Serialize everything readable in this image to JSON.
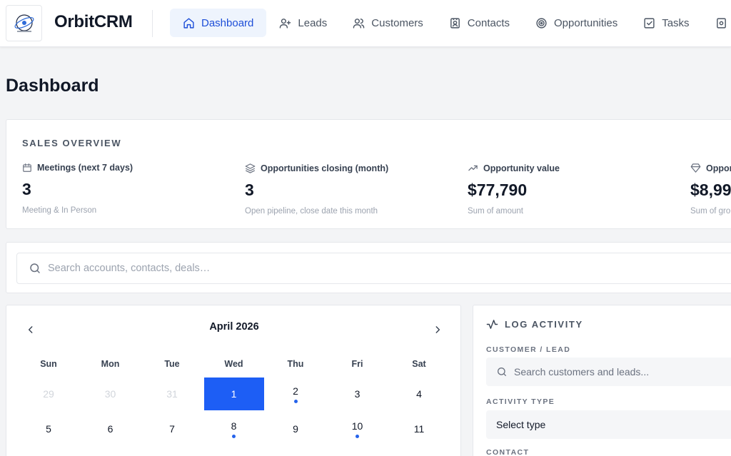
{
  "app": {
    "brand": "OrbitCRM"
  },
  "nav": [
    {
      "label": "Dashboard",
      "icon": "home-icon",
      "active": true
    },
    {
      "label": "Leads",
      "icon": "user-plus-icon"
    },
    {
      "label": "Customers",
      "icon": "users-icon"
    },
    {
      "label": "Contacts",
      "icon": "contact-card-icon"
    },
    {
      "label": "Opportunities",
      "icon": "target-icon"
    },
    {
      "label": "Tasks",
      "icon": "checkbox-icon"
    }
  ],
  "page": {
    "title": "Dashboard"
  },
  "overview": {
    "label": "SALES OVERVIEW",
    "kpis": [
      {
        "title": "Meetings (next 7 days)",
        "value": "3",
        "sub": "Meeting & In Person",
        "icon": "calendar-icon"
      },
      {
        "title": "Opportunities closing (month)",
        "value": "3",
        "sub": "Open pipeline, close date this month",
        "icon": "layers-icon"
      },
      {
        "title": "Opportunity value",
        "value": "$77,790",
        "sub": "Sum of amount",
        "icon": "trend-up-icon"
      },
      {
        "title": "Oppor",
        "value": "$8,99",
        "sub": "Sum of gro",
        "icon": "diamond-icon"
      }
    ]
  },
  "search": {
    "placeholder": "Search accounts, contacts, deals…"
  },
  "calendar": {
    "month": "April 2026",
    "weekdays": [
      "Sun",
      "Mon",
      "Tue",
      "Wed",
      "Thu",
      "Fri",
      "Sat"
    ],
    "rows": [
      [
        {
          "d": "29",
          "muted": true
        },
        {
          "d": "30",
          "muted": true
        },
        {
          "d": "31",
          "muted": true
        },
        {
          "d": "1",
          "today": true
        },
        {
          "d": "2",
          "dot": true
        },
        {
          "d": "3"
        },
        {
          "d": "4"
        }
      ],
      [
        {
          "d": "5"
        },
        {
          "d": "6"
        },
        {
          "d": "7"
        },
        {
          "d": "8",
          "dot": true
        },
        {
          "d": "9"
        },
        {
          "d": "10",
          "dot": true
        },
        {
          "d": "11"
        }
      ]
    ],
    "accent": "#1d5ef5"
  },
  "log_activity": {
    "title": "LOG ACTIVITY",
    "customer_label": "CUSTOMER / LEAD",
    "customer_placeholder": "Search customers and leads...",
    "type_label": "ACTIVITY TYPE",
    "type_value": "Select type",
    "contact_label": "CONTACT"
  }
}
